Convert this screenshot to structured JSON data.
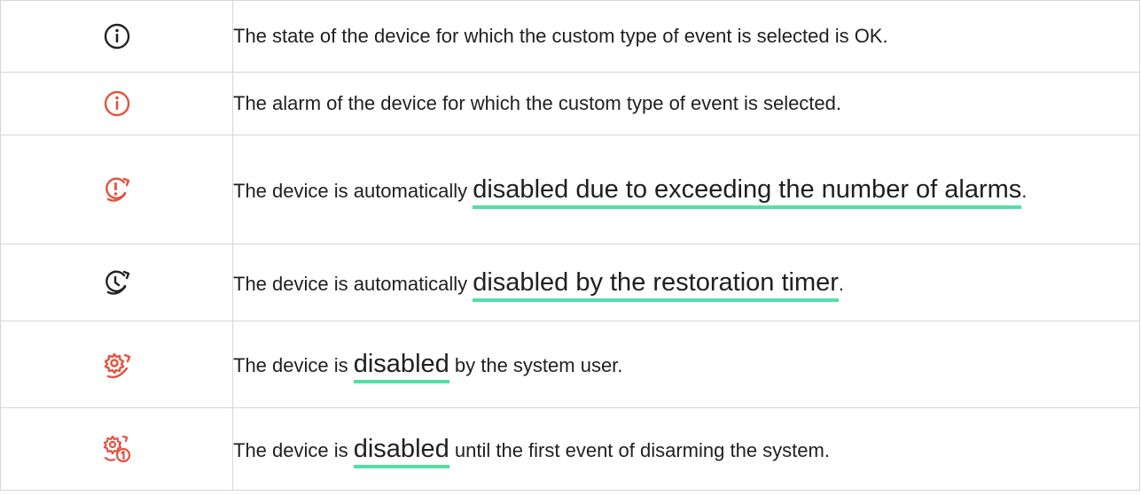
{
  "colors": {
    "accent_underline": "#52dfa5",
    "alarm_red": "#e8503f",
    "neutral_icon": "#222222",
    "border": "#d6d6d6"
  },
  "rows": [
    {
      "icon": "info-icon",
      "icon_color": "#222222",
      "text": "The state of the device for which the custom type of event is selected is OK."
    },
    {
      "icon": "info-alarm-icon",
      "icon_color": "#e8503f",
      "text": "The alarm of the device for which the custom type of event is selected."
    },
    {
      "icon": "alarm-count-disable-icon",
      "icon_color": "#e8503f",
      "before": "The device is automatically ",
      "link": "disabled due to exceeding the number of alarms",
      "after": "."
    },
    {
      "icon": "restoration-timer-icon",
      "icon_color": "#222222",
      "before": "The device is automatically ",
      "link": "disabled by the restoration timer",
      "after": "."
    },
    {
      "icon": "gear-disable-icon",
      "icon_color": "#e8503f",
      "before": "The device is ",
      "link": "disabled",
      "after": " by the system user."
    },
    {
      "icon": "gear-disarm-once-icon",
      "icon_color": "#e8503f",
      "before": "The device is ",
      "link": "disabled",
      "after": " until the first event of disarming the system."
    }
  ]
}
